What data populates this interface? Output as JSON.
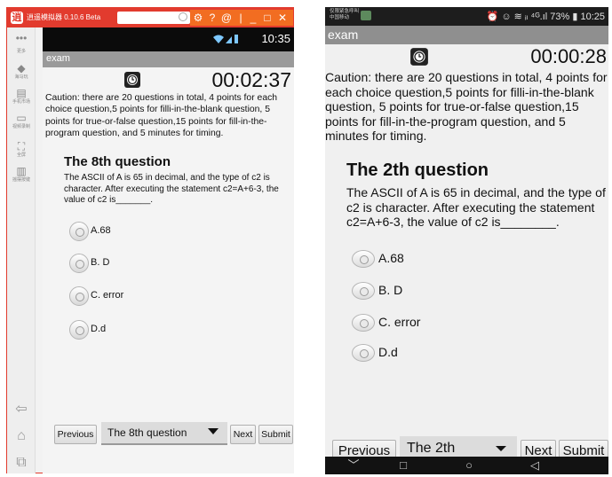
{
  "emulator": {
    "logo": "逍",
    "title": "逍遥模拟器 0.10.6 Beta",
    "window_controls": [
      "⚙",
      "?",
      "@",
      "|",
      "_",
      "□",
      "✕"
    ],
    "sidebar": [
      {
        "icon": "more-icon",
        "glyph": "•••",
        "label": ""
      },
      {
        "icon": "more-label",
        "glyph": "",
        "label": "更多"
      },
      {
        "icon": "mic-icon",
        "glyph": "◆",
        "label": "海马玩"
      },
      {
        "icon": "apk-icon",
        "glyph": "▤",
        "label": "手机市场"
      },
      {
        "icon": "video-icon",
        "glyph": "▭",
        "label": "视频录制"
      },
      {
        "icon": "fullscreen-icon",
        "glyph": "⛶",
        "label": "全屏"
      },
      {
        "icon": "shake-icon",
        "glyph": "▥",
        "label": "摇摆按键"
      }
    ],
    "nav_buttons": {
      "back": "⇦",
      "home": "⌂",
      "recent": "⧉"
    },
    "status_time": "10:35",
    "app_title": "exam",
    "timer": "00:02:37",
    "caution": "Caution: there are 20 questions in total, 4 points for each choice question,5 points for filli-in-the-blank question, 5 points for true-or-false question,15 points for fill-in-the-program question, and 5 minutes for timing.",
    "question_title": "The 8th question",
    "question_text": "The ASCII of A is 65 in decimal, and the type of c2 is character. After executing the statement c2=A+6-3, the value of c2 is_______.",
    "options": [
      "A.68",
      "B. D",
      "C. error",
      "D.d"
    ],
    "buttons": {
      "previous": "Previous",
      "next": "Next",
      "submit": "Submit"
    },
    "spinner_value": "The 8th question"
  },
  "phone": {
    "carrier": "仅限紧急呼叫\n中国移动",
    "status_right": "⏰ ☺ ≋ ᵢₗ ⁴ᴳ.ıl 73% ▮ 10:25",
    "app_title": "exam",
    "timer": "00:00:28",
    "caution": "Caution: there are 20 questions in total, 4 points for each choice question,5 points for filli-in-the-blank question, 5 points for true-or-false question,15 points for fill-in-the-program question, and 5 minutes for timing.",
    "question_title": "The 2th question",
    "question_text": "The ASCII of A is 65 in decimal, and the type of c2 is character. After executing the statement c2=A+6-3, the value of c2 is________.",
    "options": [
      "A.68",
      "B. D",
      "C. error",
      "D.d"
    ],
    "buttons": {
      "previous": "Previous",
      "next": "Next",
      "submit": "Submit"
    },
    "spinner_value": "The 2th",
    "nav_buttons": {
      "hide": "﹀",
      "recent": "□",
      "home": "○",
      "back": "◁"
    }
  },
  "colors": {
    "emulator_frame": "#e23b2e",
    "emulator_controls": "#f26d21",
    "appbar": "#9a9a9a",
    "status_bar": "#0b0b0b"
  }
}
